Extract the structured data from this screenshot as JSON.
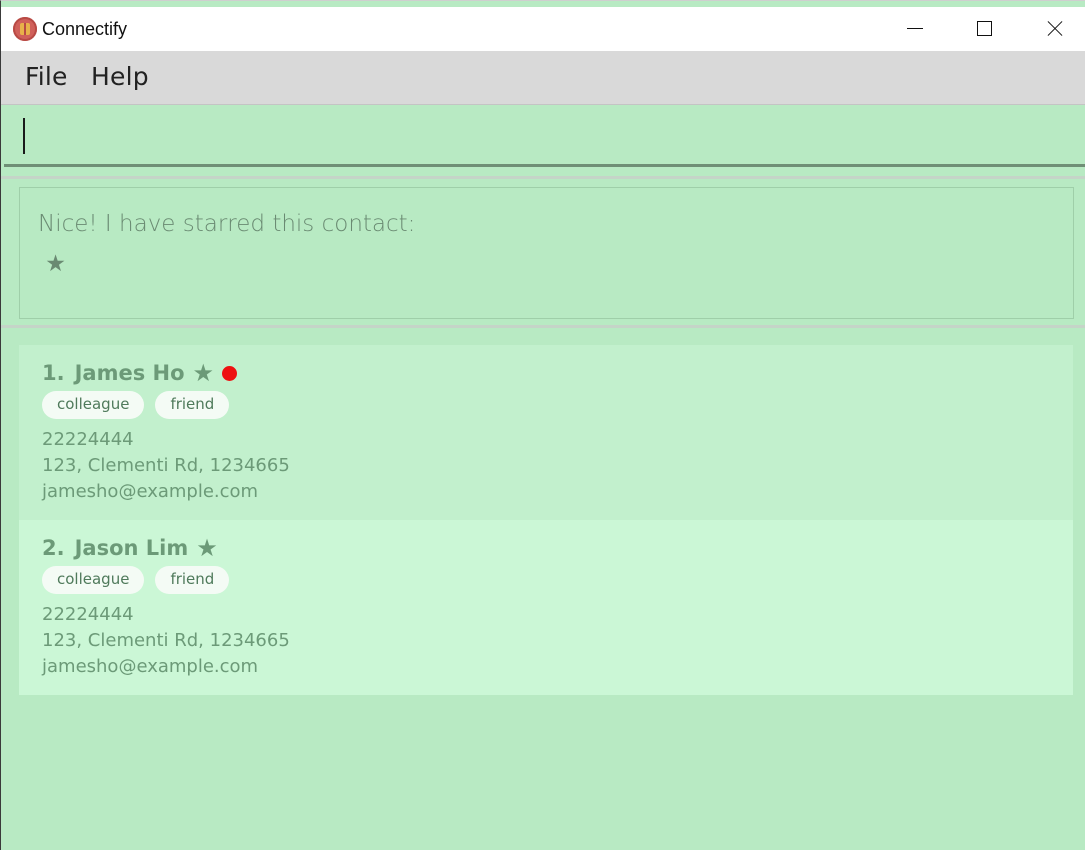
{
  "window": {
    "title": "Connectify"
  },
  "menu": {
    "items": [
      "File",
      "Help"
    ]
  },
  "command_box": {
    "value": ""
  },
  "result_display": {
    "message": "Nice! I have starred this contact:\n ★"
  },
  "contacts": [
    {
      "index": "1.",
      "name": "James Ho",
      "starred_icon": "star-icon",
      "status_icon": "red-dot",
      "tags": [
        "colleague",
        "friend"
      ],
      "phone": "22224444",
      "address": "123, Clementi Rd, 1234665",
      "email": "jamesho@example.com"
    },
    {
      "index": "2.",
      "name": "Jason Lim",
      "starred_icon": "star-icon",
      "tags": [
        "colleague",
        "friend"
      ],
      "phone": "22224444",
      "address": "123, Clementi Rd, 1234665",
      "email": "jamesho@example.com"
    }
  ],
  "colors": {
    "background": "#b8eac3",
    "card_odd": "#c2f0cd",
    "card_even": "#cbf7d6",
    "text": "#6c9a78",
    "status_dot": "#ee1111"
  }
}
